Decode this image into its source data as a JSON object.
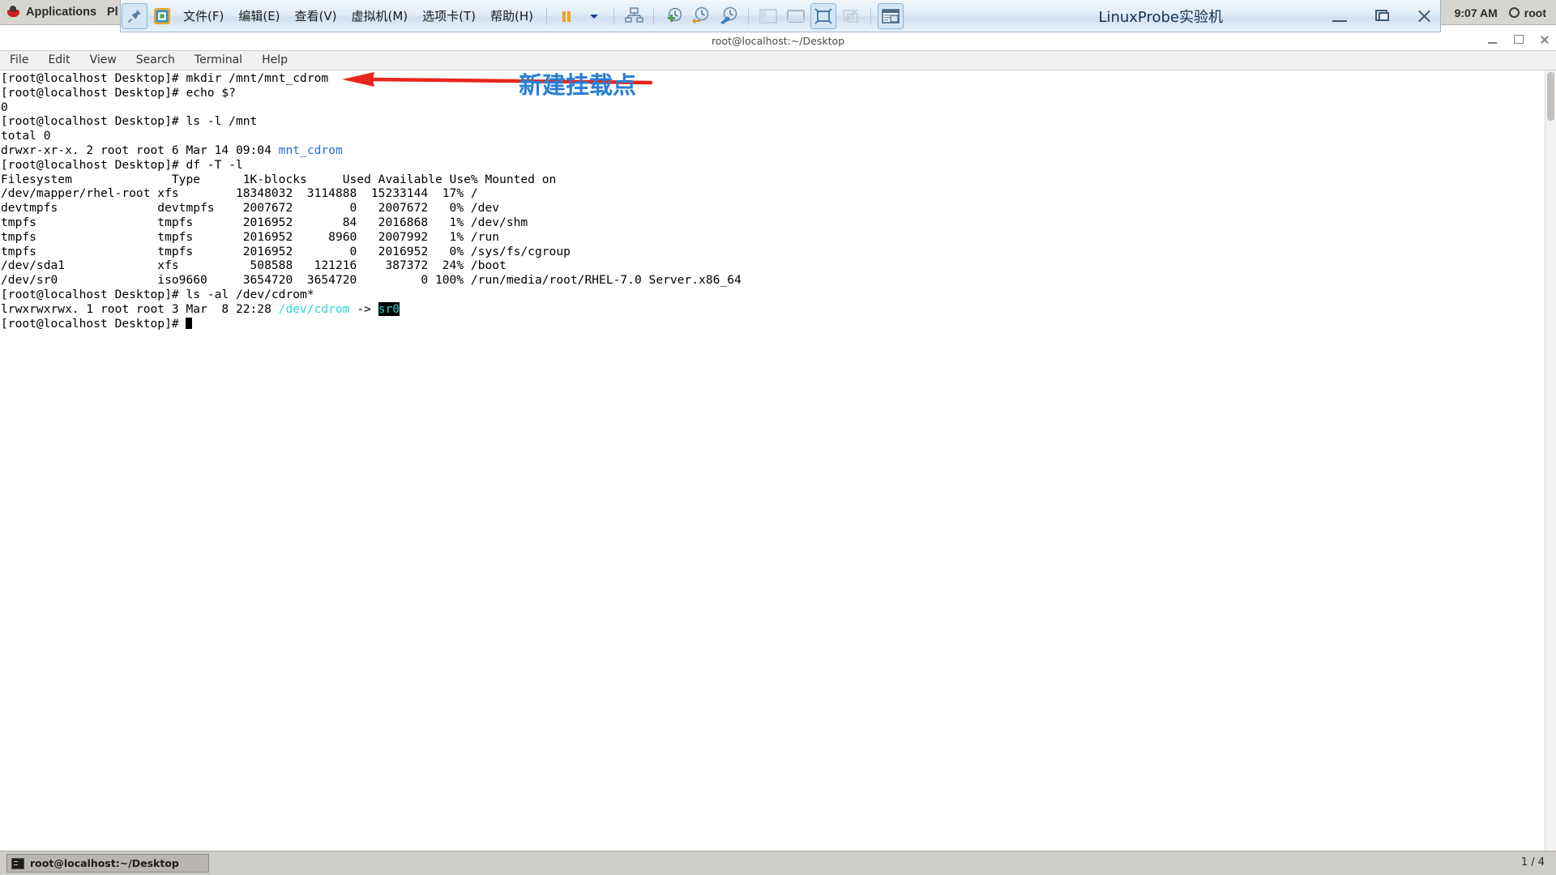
{
  "host_bar": {
    "apps_label": "Applications",
    "places_label": "Pl",
    "clock": "9:07 AM",
    "user": "root",
    "redhat_icon": "redhat-icon"
  },
  "vmware": {
    "title": "LinuxProbe实验机",
    "menus": [
      {
        "label": "文件(F)",
        "name": "menu-file"
      },
      {
        "label": "编辑(E)",
        "name": "menu-edit"
      },
      {
        "label": "查看(V)",
        "name": "menu-view"
      },
      {
        "label": "虚拟机(M)",
        "name": "menu-vm"
      },
      {
        "label": "选项卡(T)",
        "name": "menu-tabs"
      },
      {
        "label": "帮助(H)",
        "name": "menu-help"
      }
    ],
    "toolbar_icons": [
      "pin-icon",
      "vmware-logo-icon",
      "pause-icon",
      "dropdown-caret-icon",
      "snapshot-manager-icon",
      "take-snapshot-icon",
      "revert-snapshot-icon",
      "manage-snapshot-icon",
      "show-sidebar-icon",
      "show-console-icon",
      "fullscreen-icon",
      "unity-mode-icon",
      "library-icon"
    ],
    "window_controls": [
      "minimize",
      "restore",
      "close"
    ],
    "guest_title": "root@localhost:~/Desktop",
    "tab_controls": [
      "minimize",
      "maximize",
      "close"
    ]
  },
  "terminal": {
    "menus": [
      "File",
      "Edit",
      "View",
      "Search",
      "Terminal",
      "Help"
    ],
    "prompt": "[root@localhost Desktop]# ",
    "lines": [
      {
        "type": "prompt",
        "cmd": "mkdir /mnt/mnt_cdrom"
      },
      {
        "type": "prompt",
        "cmd": "echo $?"
      },
      {
        "type": "out",
        "text": "0"
      },
      {
        "type": "prompt",
        "cmd": "ls -l /mnt"
      },
      {
        "type": "out",
        "text": "total 0"
      },
      {
        "type": "dir",
        "pre": "drwxr-xr-x. 2 root root 6 Mar 14 09:04 ",
        "name": "mnt_cdrom"
      },
      {
        "type": "prompt",
        "cmd": "df -T -l"
      },
      {
        "type": "out",
        "text": "Filesystem              Type      1K-blocks     Used Available Use% Mounted on"
      },
      {
        "type": "out",
        "text": "/dev/mapper/rhel-root xfs        18348032  3114888  15233144  17% /"
      },
      {
        "type": "out",
        "text": "devtmpfs              devtmpfs    2007672        0   2007672   0% /dev"
      },
      {
        "type": "out",
        "text": "tmpfs                 tmpfs       2016952       84   2016868   1% /dev/shm"
      },
      {
        "type": "out",
        "text": "tmpfs                 tmpfs       2016952     8960   2007992   1% /run"
      },
      {
        "type": "out",
        "text": "tmpfs                 tmpfs       2016952        0   2016952   0% /sys/fs/cgroup"
      },
      {
        "type": "out",
        "text": "/dev/sda1             xfs          508588   121216    387372  24% /boot"
      },
      {
        "type": "out",
        "text": "/dev/sr0              iso9660     3654720  3654720         0 100% /run/media/root/RHEL-7.0 Server.x86_64"
      },
      {
        "type": "prompt",
        "cmd": "ls -al /dev/cdrom*"
      },
      {
        "type": "link",
        "pre": "lrwxrwxrwx. 1 root root 3 Mar  8 22:28 ",
        "target": "/dev/cdrom",
        "arrow": " -> ",
        "dest": "sr0"
      },
      {
        "type": "prompt-cursor",
        "cmd": ""
      }
    ]
  },
  "annotation": {
    "text": "新建挂载点",
    "arrow_color": "#e8261c",
    "text_color": "#2a7fd4"
  },
  "taskbar": {
    "window_label": "root@localhost:~/Desktop",
    "workspace": "1 / 4",
    "icon": "terminal-icon"
  },
  "colors": {
    "terminal_bg": "#ffffff",
    "terminal_fg": "#000000",
    "dir_blue": "#2d6ccf",
    "symlink_cyan": "#2ad4d4",
    "vmware_toolbar": "#dceaf7"
  }
}
